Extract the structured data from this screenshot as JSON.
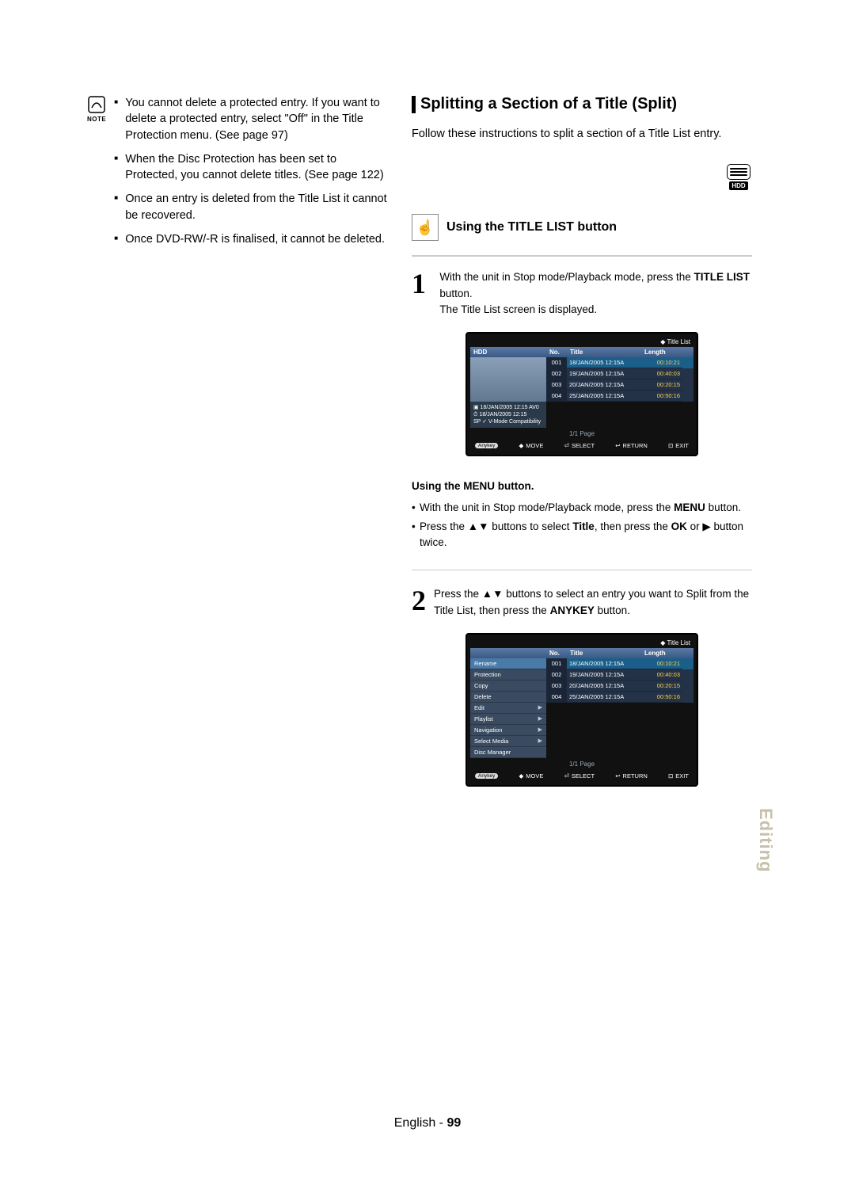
{
  "note": {
    "label": "NOTE",
    "items": [
      "You cannot delete a protected entry. If you want to delete a protected entry, select \"Off\" in the Title Protection menu. (See page 97)",
      "When the Disc Protection has been set to Protected, you cannot delete titles. (See page 122)",
      "Once an entry is deleted from the Title List it cannot be recovered.",
      "Once DVD-RW/-R is finalised, it cannot be deleted."
    ]
  },
  "section": {
    "title": "Splitting a Section of a Title (Split)",
    "desc": "Follow these instructions to split a section of a Title List entry."
  },
  "hdd_label": "HDD",
  "sub_heading": "Using the TITLE LIST button",
  "step1": {
    "num": "1",
    "line1": "With the unit in Stop mode/Playback mode, press the ",
    "bold1": "TITLE LIST",
    "line1b": " button.",
    "line2": "The Title List screen is displayed."
  },
  "screenshot1": {
    "top_label": "Title List",
    "hdr_media": "HDD",
    "hdr_no": "No.",
    "hdr_title": "Title",
    "hdr_length": "Length",
    "rows": [
      {
        "no": "001",
        "title": "18/JAN/2005 12:15A",
        "length": "00:10:21"
      },
      {
        "no": "002",
        "title": "19/JAN/2005 12:15A",
        "length": "00:40:03"
      },
      {
        "no": "003",
        "title": "20/JAN/2005 12:15A",
        "length": "00:20:15"
      },
      {
        "no": "004",
        "title": "25/JAN/2005 12:15A",
        "length": "00:50:16"
      }
    ],
    "meta_line1": "18/JAN/2005 12:15 AV0",
    "meta_line2": "18/JAN/2005 12:15",
    "meta_line3": "SP ✓ V-Mode Compatibility",
    "pager": "1/1 Page",
    "footer": {
      "anykey": "Anykey",
      "move": "MOVE",
      "select": "SELECT",
      "return": "RETURN",
      "exit": "EXIT"
    }
  },
  "using_menu": {
    "title": "Using the MENU button.",
    "items": [
      {
        "pre": "With the unit in Stop mode/Playback mode, press the ",
        "bold": "MENU",
        "post": " button."
      },
      {
        "pre": "Press the ▲▼ buttons to select ",
        "bold": "Title",
        "post": ", then press the ",
        "bold2": "OK",
        "post2": " or ▶ button twice."
      }
    ]
  },
  "step2": {
    "num": "2",
    "pre": "Press the ▲▼ buttons to select an entry you want to Split from the Title List, then press the ",
    "bold": "ANYKEY",
    "post": " button."
  },
  "screenshot2": {
    "top_label": "Title List",
    "hdr_no": "No.",
    "hdr_title": "Title",
    "hdr_length": "Length",
    "menu": [
      "Rename",
      "Protection",
      "Copy",
      "Delete",
      "Edit",
      "Playlist",
      "Navigation",
      "Select Media",
      "Disc Manager"
    ],
    "menu_arrow_indices": [
      4,
      5,
      6,
      7
    ],
    "rows": [
      {
        "no": "001",
        "title": "18/JAN/2005 12:15A",
        "length": "00:10:21"
      },
      {
        "no": "002",
        "title": "19/JAN/2005 12:15A",
        "length": "00:40:03"
      },
      {
        "no": "003",
        "title": "20/JAN/2005 12:15A",
        "length": "00:20:15"
      },
      {
        "no": "004",
        "title": "25/JAN/2005 12:15A",
        "length": "00:50:16"
      }
    ],
    "pager": "1/1 Page",
    "footer": {
      "anykey": "Anykey",
      "move": "MOVE",
      "select": "SELECT",
      "return": "RETURN",
      "exit": "EXIT"
    }
  },
  "side_tab": "Editing",
  "footer_text": {
    "lang": "English",
    "sep": " - ",
    "page": "99"
  }
}
